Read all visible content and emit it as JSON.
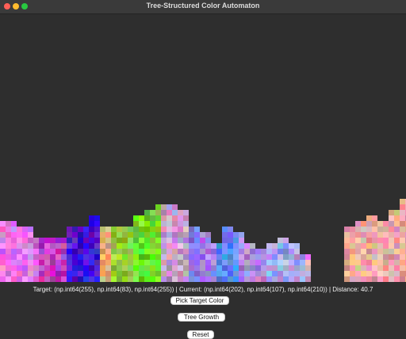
{
  "window": {
    "title": "Tree-Structured Color Automaton"
  },
  "status_text": "Target: (np.int64(255), np.int64(83), np.int64(255)) | Current: (np.int64(202), np.int64(107), np.int64(210)) | Distance: 40.7",
  "buttons": {
    "pick_target": "Pick Target Color",
    "tree_growth": "Tree Growth",
    "reset": "Reset"
  },
  "colors": {
    "background": "#2e2e2e",
    "target": "#ff53ff",
    "current": "#ca6bd2"
  }
}
